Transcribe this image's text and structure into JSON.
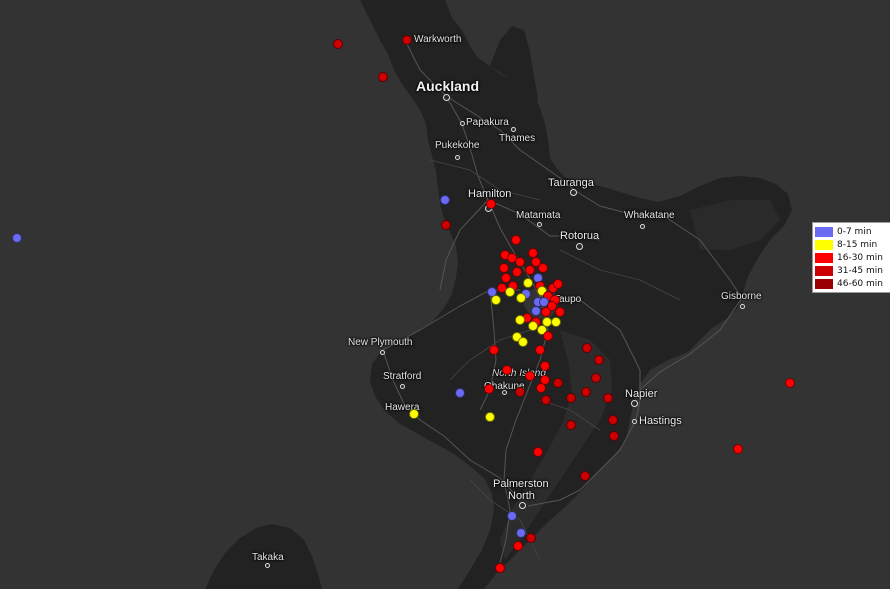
{
  "places": {
    "warkworth": "Warkworth",
    "auckland": "Auckland",
    "papakura": "Papakura",
    "pukekohe": "Pukekohe",
    "thames": "Thames",
    "tauranga": "Tauranga",
    "hamilton": "Hamilton",
    "matamata": "Matamata",
    "whakatane": "Whakatane",
    "rotorua": "Rotorua",
    "taupo": "Taupo",
    "gisborne": "Gisborne",
    "new_plymouth": "New Plymouth",
    "stratford": "Stratford",
    "north_island": "North Island",
    "ohakune": "Ohakune",
    "napier": "Napier",
    "hastings": "Hastings",
    "hawera": "Hawera",
    "palmerston_north_1": "Palmerston",
    "palmerston_north_2": "North",
    "takaka": "Takaka"
  },
  "legend": [
    {
      "label": "0-7 min",
      "color": "#6a6af2"
    },
    {
      "label": "8-15 min",
      "color": "#ffff00"
    },
    {
      "label": "16-30 min",
      "color": "#ff0000"
    },
    {
      "label": "31-45 min",
      "color": "#cc0000"
    },
    {
      "label": "46-60 min",
      "color": "#990000"
    }
  ],
  "colors": {
    "background": "#333333",
    "land": "#212121",
    "roads": "#5a5a5a"
  }
}
